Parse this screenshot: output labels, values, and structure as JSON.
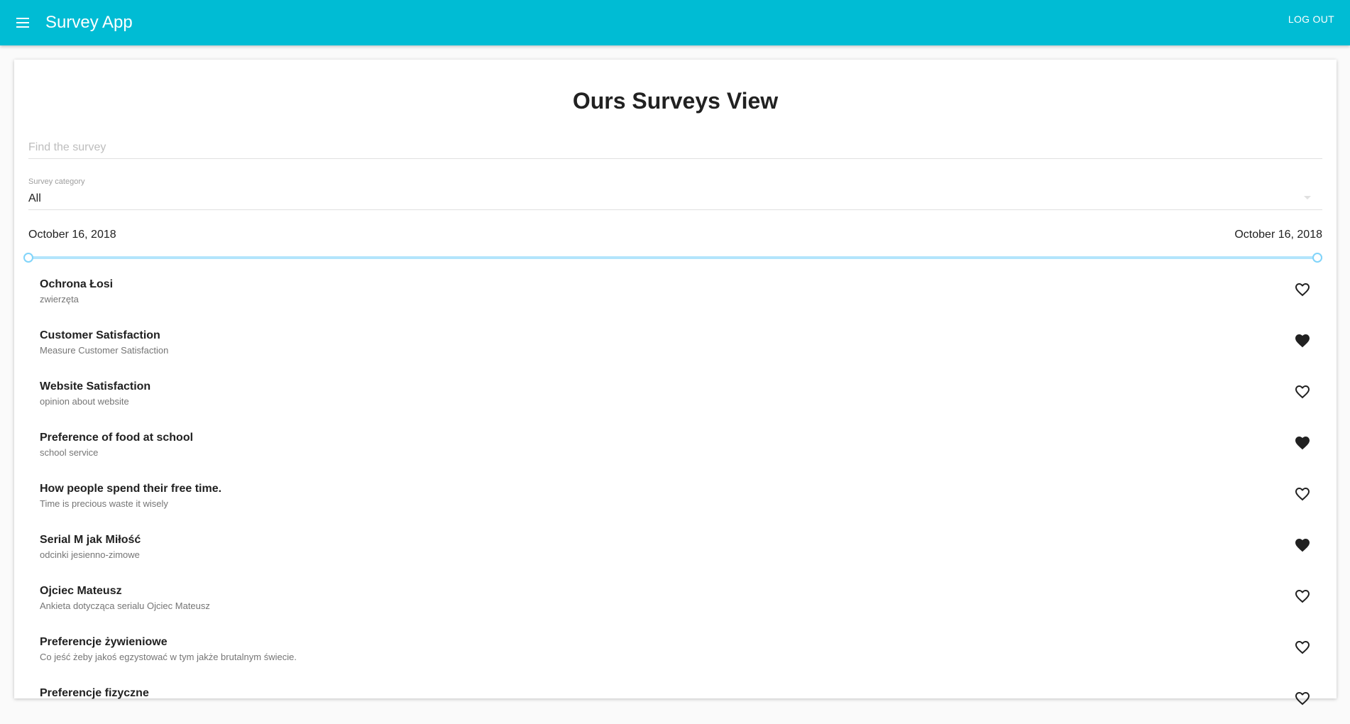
{
  "app": {
    "title": "Survey App",
    "logout_label": "LOG OUT"
  },
  "page": {
    "title": "Ours Surveys View"
  },
  "search": {
    "placeholder": "Find the survey",
    "value": ""
  },
  "category": {
    "label": "Survey category",
    "value": "All"
  },
  "date_range": {
    "start": "October 16, 2018",
    "end": "October 16, 2018",
    "range_fraction": [
      0,
      1
    ]
  },
  "colors": {
    "appbar": "#00bcd4",
    "slider": "#b3e5fc",
    "heart": "#212121"
  },
  "icons": {
    "menu": "menu-icon",
    "favorite": "heart-icon",
    "dropdown": "triangle-down-icon"
  },
  "surveys": [
    {
      "title": "Ochrona Łosi",
      "subtitle": "zwierzęta",
      "favorite": false
    },
    {
      "title": "Customer Satisfaction",
      "subtitle": "Measure Customer Satisfaction",
      "favorite": true
    },
    {
      "title": "Website Satisfaction",
      "subtitle": "opinion about website",
      "favorite": false
    },
    {
      "title": "Preference of food at school",
      "subtitle": "school service",
      "favorite": true
    },
    {
      "title": "How people spend their free time.",
      "subtitle": "Time is precious waste it wisely",
      "favorite": false
    },
    {
      "title": "Serial M jak Miłość",
      "subtitle": "odcinki jesienno-zimowe",
      "favorite": true
    },
    {
      "title": "Ojciec Mateusz",
      "subtitle": "Ankieta dotycząca serialu Ojciec Mateusz",
      "favorite": false
    },
    {
      "title": "Preferencje żywieniowe",
      "subtitle": "Co jeść żeby jakoś egzystować w tym jakże brutalnym świecie.",
      "favorite": false
    },
    {
      "title": "Preferencje fizyczne",
      "subtitle": "",
      "favorite": false
    }
  ]
}
